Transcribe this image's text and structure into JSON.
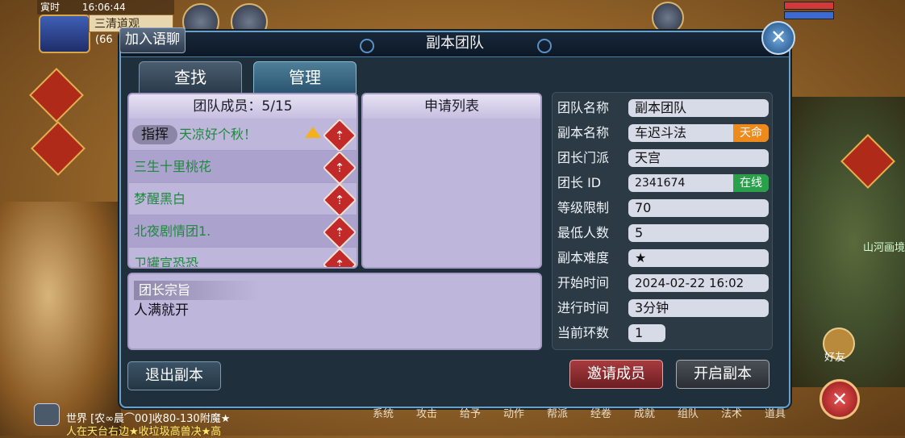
{
  "hud": {
    "time_tag": "寅时",
    "clock": "16:06:44",
    "map_name": "三清道观",
    "level_partial": "(66"
  },
  "chat_join": "加入语聊",
  "panel": {
    "title": "副本团队",
    "close_glyph": "✕"
  },
  "tabs": [
    "查找",
    "管理"
  ],
  "members": {
    "header": "团队成员：5/15",
    "leader_tag": "指挥",
    "role_glyph": "⇡",
    "list": [
      {
        "name": "天凉好个秋！"
      },
      {
        "name": "三生十里桃花"
      },
      {
        "name": "梦醒黑白"
      },
      {
        "name": "北夜剧情团1."
      },
      {
        "name": "卫罐宣恐恐"
      }
    ]
  },
  "apply_list": {
    "header": "申请列表"
  },
  "purpose": {
    "label": "团长宗旨",
    "text": "人满就开"
  },
  "info": {
    "team_name_label": "团队名称",
    "team_name": "副本团队",
    "instance_label": "副本名称",
    "instance": "车迟斗法",
    "instance_badge": "天命",
    "sect_label": "团长门派",
    "sect": "天宫",
    "leader_id_label": "团长  ID",
    "leader_id": "2341674",
    "online_badge": "在线",
    "level_label": "等级限制",
    "level": "70",
    "min_label": "最低人数",
    "min": "5",
    "difficulty_label": "副本难度",
    "difficulty": "★",
    "start_label": "开始时间",
    "start": "2024-02-22 16:02",
    "elapsed_label": "进行时间",
    "elapsed": "3分钟",
    "ring_label": "当前环数",
    "ring": "1"
  },
  "buttons": {
    "exit": "退出副本",
    "invite": "邀请成员",
    "start": "开启副本"
  },
  "chat": {
    "line1": "世界 [农∞晨⌒00]收80-130附魔★",
    "line2": "人在天台右边★收垃圾高兽决★高"
  },
  "bottom_menu": [
    "系统",
    "攻击",
    "给予",
    "动作",
    "帮派",
    "经卷",
    "成就",
    "组队",
    "法术",
    "道具"
  ],
  "right_label": "山河画境",
  "friend_label": "好友",
  "colors": {
    "panel_bg": "#1f2f3c",
    "member_name": "#1e8a3c",
    "badge_orange": "#ee8a1c",
    "badge_green": "#2aa04a",
    "invite_button": "#a83b3e"
  },
  "icons": {
    "close": "close-icon",
    "role": "role-weapon-icon",
    "up": "promote-arrow-icon",
    "chat": "chat-bubble-icon"
  }
}
